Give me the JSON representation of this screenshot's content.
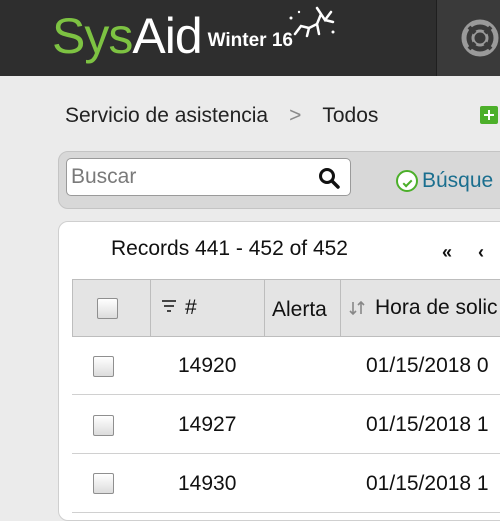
{
  "header": {
    "logo_sys": "Sys",
    "logo_aid": "Aid",
    "logo_season": "Winter 16",
    "help_icon": "lifebuoy-icon"
  },
  "breadcrumb": {
    "items": [
      "Servicio de asistencia",
      "Todos"
    ],
    "separator": ">"
  },
  "toolbar": {
    "search_placeholder": "Buscar",
    "search_value": "",
    "advanced_search_label": "Búsque",
    "add_icon": "plus-icon"
  },
  "list": {
    "records_label": "Records 441 - 452 of 452",
    "pager_first": "«",
    "pager_prev": "‹",
    "columns": [
      "#",
      "Alerta",
      "Hora de solic"
    ],
    "rows": [
      {
        "id": "14920",
        "alert": "",
        "time": "01/15/2018 0"
      },
      {
        "id": "14927",
        "alert": "",
        "time": "01/15/2018 1"
      },
      {
        "id": "14930",
        "alert": "",
        "time": "01/15/2018 1"
      }
    ]
  },
  "colors": {
    "topbar": "#2e2e2e",
    "brand_green": "#7dc242",
    "link": "#1b6f8f"
  }
}
